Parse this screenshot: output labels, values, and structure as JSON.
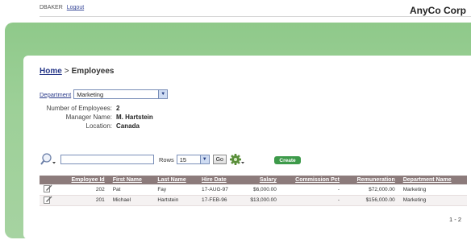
{
  "header": {
    "username": "DBAKER",
    "logout_label": "Logout",
    "brand": "AnyCo Corp"
  },
  "breadcrumb": {
    "home": "Home",
    "separator": ">",
    "current": "Employees"
  },
  "filter": {
    "department_label": "Department",
    "department_value": "Marketing"
  },
  "summary": [
    {
      "label": "Number of Employees:",
      "value": "2"
    },
    {
      "label": "Manager Name:",
      "value": "M. Hartstein"
    },
    {
      "label": "Location:",
      "value": "Canada"
    }
  ],
  "toolbar": {
    "search_value": "",
    "rows_label": "Rows",
    "rows_value": "15",
    "go_label": "Go",
    "create_label": "Create"
  },
  "table": {
    "columns": [
      "Employee Id",
      "First Name",
      "Last Name",
      "Hire Date",
      "Salary",
      "Commission Pct",
      "Remuneration",
      "Department Name"
    ],
    "rows": [
      {
        "employee_id": "202",
        "first_name": "Pat",
        "last_name": "Fay",
        "hire_date": "17-AUG-97",
        "salary": "$6,000.00",
        "commission_pct": "-",
        "remuneration": "$72,000.00",
        "department_name": "Marketing"
      },
      {
        "employee_id": "201",
        "first_name": "Michael",
        "last_name": "Hartstein",
        "hire_date": "17-FEB-96",
        "salary": "$13,000.00",
        "commission_pct": "-",
        "remuneration": "$156,000.00",
        "department_name": "Marketing"
      }
    ]
  },
  "pagination": "1 - 2",
  "colors": {
    "accent_green": "#3d9a4a",
    "band_green": "#9dd098",
    "table_header": "#8c7b7b",
    "link": "#2a3a8a"
  },
  "icons": {
    "search": "search-icon",
    "gear": "gear-icon",
    "edit": "edit-icon",
    "dropdown": "chevron-down-icon"
  }
}
